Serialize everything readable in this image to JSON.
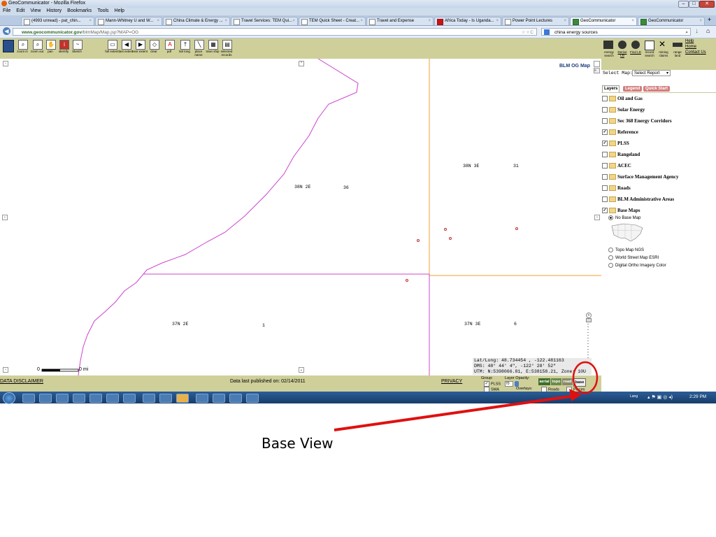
{
  "window": {
    "title": "GeoCommunicator - Mozilla Firefox",
    "min": "–",
    "max": "□",
    "close": "✕"
  },
  "menu": [
    "File",
    "Edit",
    "View",
    "History",
    "Bookmarks",
    "Tools",
    "Help"
  ],
  "tabs": [
    {
      "label": "(4993 unread) - pat_chin..."
    },
    {
      "label": "Mann-Whitney U and W..."
    },
    {
      "label": "China Climate & Energy ..."
    },
    {
      "label": "Travel Services: TEM Qui..."
    },
    {
      "label": "TEM Quick Sheet - Creat..."
    },
    {
      "label": "Travel and Expense"
    },
    {
      "label": "Africa Today - Is Uganda..."
    },
    {
      "label": "Power Point Lectures"
    },
    {
      "label": "GeoCommunicator",
      "active": true
    },
    {
      "label": "GeoCommunicator"
    }
  ],
  "nav": {
    "url_domain": "www.geocommunicator.gov",
    "url_path": "/blmMap/Map.jsp?MAP=OG",
    "search_value": "china energy sources"
  },
  "toolbar": {
    "tools": [
      {
        "label": "zoom in",
        "icon": "zoom-in-icon"
      },
      {
        "label": "zoom out",
        "icon": "zoom-out-icon"
      },
      {
        "label": "pan",
        "icon": "pan-icon"
      },
      {
        "label": "identify",
        "icon": "identify-icon"
      },
      {
        "label": "Sketch",
        "icon": "sketch-icon"
      },
      {
        "label": "full extent",
        "icon": "full-extent-icon"
      },
      {
        "label": "last extent",
        "icon": "last-extent-icon"
      },
      {
        "label": "next extent",
        "icon": "next-extent-icon"
      },
      {
        "label": "clear",
        "icon": "clear-icon"
      },
      {
        "label": "pdf",
        "icon": "pdf-icon"
      },
      {
        "label": "lat/ long",
        "icon": "latlong-icon"
      },
      {
        "label": "place name",
        "icon": "place-name-icon"
      },
      {
        "label": "town ship",
        "icon": "township-icon"
      },
      {
        "label": "selected records",
        "icon": "selected-records-icon"
      }
    ],
    "right_tools": [
      {
        "label": "energy search"
      },
      {
        "label": "Derive LD"
      },
      {
        "label": "Find LD"
      },
      {
        "label": "record search"
      },
      {
        "label": "mining claims"
      },
      {
        "label": "range land"
      }
    ],
    "links": {
      "help": "Help",
      "home": "Home",
      "contact": "Contact Us"
    }
  },
  "map": {
    "brand": "BLM OG Map",
    "labels": {
      "t38n2e": "38N 2E",
      "s36": "36",
      "t38n3e": "38N 3E",
      "s31": "31",
      "t37n2e": "37N 2E",
      "s1": "1",
      "t37n3e": "37N 3E",
      "s6": "6"
    },
    "scale_left": "0",
    "scale_right": "0 mi"
  },
  "coords": {
    "latlong": "Lat/Long: 48.734454 , -122.481163",
    "dms": "DMS: 48° 44' 4\", -122° 28' 52\"",
    "utm": "UTM: N:5398066.81, E:538158.21, Zone: 10U"
  },
  "overlay_ctrl": {
    "group": "Group:",
    "opacity": "Layer Opacity:",
    "plss": "PLSS",
    "sma": "SMA",
    "opacity_value": "70",
    "overlays": "Overlays:",
    "roads": "Roads",
    "places": "Places",
    "btn_aerial": "aerial",
    "btn_topo": "topo",
    "btn_road": "road",
    "btn_base": "base"
  },
  "bottom": {
    "disclaimer": "DATA DISCLAIMER",
    "published": "Data last published on: 02/14/2011",
    "privacy": "PRIVACY"
  },
  "panel": {
    "select_map_label": "Select Map:",
    "select_map_value": "Select Report",
    "tabs": [
      "Layers",
      "Legend",
      "Quick Start"
    ],
    "layers": [
      {
        "label": "Oil and Gas",
        "checked": false
      },
      {
        "label": "Solar Energy",
        "checked": false
      },
      {
        "label": "Sec 368 Energy Corridors",
        "checked": false
      },
      {
        "label": "Reference",
        "checked": true
      },
      {
        "label": "PLSS",
        "checked": true
      },
      {
        "label": "Rangeland",
        "checked": false
      },
      {
        "label": "ACEC",
        "checked": false
      },
      {
        "label": "Surface Management Agency",
        "checked": false
      },
      {
        "label": "Roads",
        "checked": false
      },
      {
        "label": "BLM Administrative Areas",
        "checked": false
      },
      {
        "label": "Base Maps",
        "checked": true
      }
    ],
    "basemaps": [
      "No Base Map",
      "Topo Map NGS",
      "World Street Map ESRI",
      "Digital Ortho Imagery Color"
    ],
    "selected_basemap": "No Base Map"
  },
  "taskbar": {
    "clock": "2:29 PM",
    "tray_text": "Lang"
  },
  "annotation": "Base View",
  "colors": {
    "toolbar_bg": "#cfcf9a",
    "plss_line": "#cc44cc",
    "orange_line": "#f0a030",
    "annotation_red": "#e01010"
  }
}
